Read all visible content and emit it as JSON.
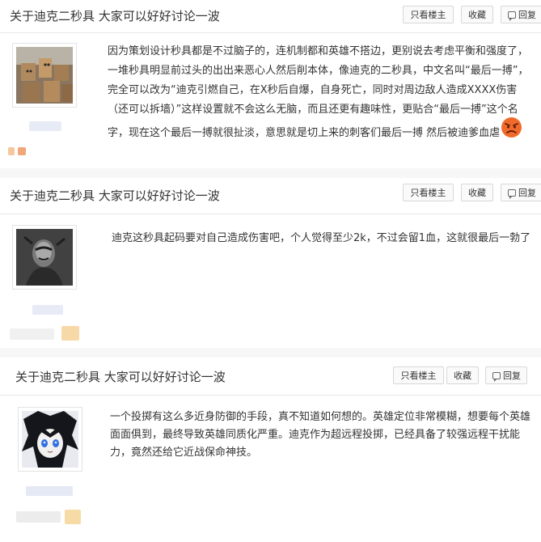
{
  "threads": [
    {
      "title": "关于迪克二秒具 大家可以好好讨论一波",
      "buttons": {
        "only_op": "只看楼主",
        "collect": "收藏",
        "reply": "回复"
      },
      "post_lines": [
        "因为策划设计秒具都是不过脑子的，连机制都和英雄不搭边，更别说去考虑平衡和强度了，",
        "一堆秒具明显前过头的出出来恶心人然后削本体，像迪克的二秒具，中文名叫“最后一搏”，",
        "完全可以改为“迪克引燃自己，在X秒后自爆，自身死亡，同时对周边敌人造成XXXX伤害",
        "（还可以拆墙）”这样设置就不会这么无脑，而且还更有趣味性，更贴合“最后一搏”这个名",
        "字，现在这个最后一搏就很扯淡，意思就是切上来的刺客们最后一搏 然后被迪爹血虐"
      ]
    },
    {
      "title": "关于迪克二秒具 大家可以好好讨论一波",
      "buttons": {
        "only_op": "只看楼主",
        "collect": "收藏",
        "reply": "回复"
      },
      "post_lines": [
        "迪克这秒具起码要对自己造成伤害吧，个人觉得至少2k，不过会留1血，这就很最后一勃了"
      ]
    },
    {
      "title": "关于迪克二秒具 大家可以好好讨论一波",
      "buttons": {
        "only_op": "只看楼主",
        "collect": "收藏",
        "reply": "回复"
      },
      "post_lines": [
        "一个投掷有这么多近身防御的手段，真不知道如何想的。英雄定位非常模糊，想要每个英雄",
        "面面俱到，最终导致英雄同质化严重。迪克作为超远程投掷，已经具备了较强远程干扰能",
        "力，竟然还给它近战保命神技。"
      ]
    }
  ],
  "icons": {
    "reply": "speech-bubble-icon",
    "emoji": "angry-face-icon"
  },
  "colors": {
    "text": "#333333",
    "border": "#d8d8d8",
    "button_bg": "#fafafa",
    "emoji": "#f06a2b"
  }
}
